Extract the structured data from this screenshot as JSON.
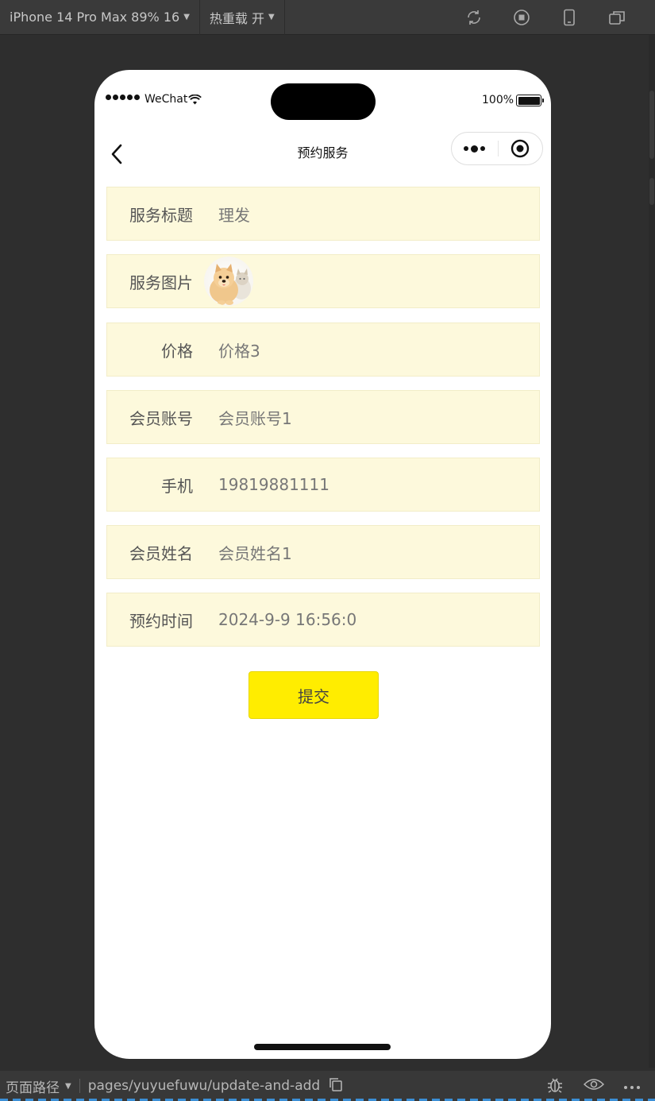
{
  "toolbar": {
    "device_label": "iPhone 14 Pro Max 89% 16",
    "hot_reload_label": "热重载 开",
    "icons": [
      "refresh-icon",
      "stop-icon",
      "phone-icon",
      "window-icon"
    ]
  },
  "status_bar": {
    "carrier": "WeChat",
    "battery": "100%"
  },
  "nav": {
    "title": "预约服务"
  },
  "form": {
    "rows": [
      {
        "label": "服务标题",
        "value": "理发"
      },
      {
        "label": "服务图片",
        "value": ""
      },
      {
        "label": "价格",
        "value": "价格3"
      },
      {
        "label": "会员账号",
        "value": "会员账号1"
      },
      {
        "label": "手机",
        "value": "19819881111"
      },
      {
        "label": "会员姓名",
        "value": "会员姓名1"
      },
      {
        "label": "预约时间",
        "value": "2024-9-9 16:56:0"
      }
    ],
    "submit_label": "提交"
  },
  "bottom_bar": {
    "path_label": "页面路径",
    "path": "pages/yuyuefuwu/update-and-add"
  },
  "colors": {
    "row_bg": "#fdf9dc",
    "submit_bg": "#ffed00"
  }
}
